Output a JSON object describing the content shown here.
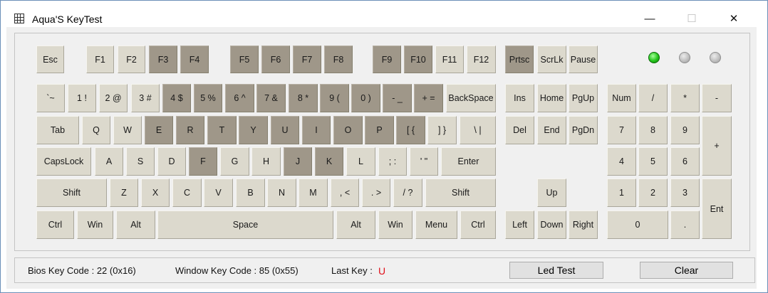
{
  "window": {
    "title": "Aqua'S KeyTest",
    "controls": {
      "minimize": "—",
      "maximize": "☐",
      "close": "✕"
    }
  },
  "colors": {
    "key_face": "#dcd9cd",
    "key_pressed": "#9f9789",
    "led_on": "#22c41a",
    "last_key": "#e0101a"
  },
  "keyboard": {
    "function_row": [
      {
        "label": "Esc",
        "pressed": false
      },
      {
        "label": "F1",
        "pressed": false
      },
      {
        "label": "F2",
        "pressed": false
      },
      {
        "label": "F3",
        "pressed": true
      },
      {
        "label": "F4",
        "pressed": true
      },
      {
        "label": "F5",
        "pressed": true
      },
      {
        "label": "F6",
        "pressed": true
      },
      {
        "label": "F7",
        "pressed": true
      },
      {
        "label": "F8",
        "pressed": true
      },
      {
        "label": "F9",
        "pressed": true
      },
      {
        "label": "F10",
        "pressed": true
      },
      {
        "label": "F11",
        "pressed": false
      },
      {
        "label": "F12",
        "pressed": false
      },
      {
        "label": "Prtsc",
        "pressed": true
      },
      {
        "label": "ScrLk",
        "pressed": false
      },
      {
        "label": "Pause",
        "pressed": false
      }
    ],
    "number_row": [
      {
        "label": "`~",
        "pressed": false
      },
      {
        "label": "1 !",
        "pressed": false
      },
      {
        "label": "2 @",
        "pressed": false
      },
      {
        "label": "3 #",
        "pressed": false
      },
      {
        "label": "4 $",
        "pressed": true
      },
      {
        "label": "5 %",
        "pressed": true
      },
      {
        "label": "6 ^",
        "pressed": true
      },
      {
        "label": "7 &",
        "pressed": true
      },
      {
        "label": "8 *",
        "pressed": true
      },
      {
        "label": "9 (",
        "pressed": true
      },
      {
        "label": "0 )",
        "pressed": true
      },
      {
        "label": "- _",
        "pressed": true
      },
      {
        "label": "+ =",
        "pressed": true
      },
      {
        "label": "BackSpace",
        "pressed": false
      }
    ],
    "tab_row": [
      {
        "label": "Tab",
        "pressed": false
      },
      {
        "label": "Q",
        "pressed": false
      },
      {
        "label": "W",
        "pressed": false
      },
      {
        "label": "E",
        "pressed": true
      },
      {
        "label": "R",
        "pressed": true
      },
      {
        "label": "T",
        "pressed": true
      },
      {
        "label": "Y",
        "pressed": true
      },
      {
        "label": "U",
        "pressed": true
      },
      {
        "label": "I",
        "pressed": true
      },
      {
        "label": "O",
        "pressed": true
      },
      {
        "label": "P",
        "pressed": true
      },
      {
        "label": "[ {",
        "pressed": true
      },
      {
        "label": "] }",
        "pressed": false
      },
      {
        "label": "\\ |",
        "pressed": false
      }
    ],
    "caps_row": [
      {
        "label": "CapsLock",
        "pressed": false
      },
      {
        "label": "A",
        "pressed": false
      },
      {
        "label": "S",
        "pressed": false
      },
      {
        "label": "D",
        "pressed": false
      },
      {
        "label": "F",
        "pressed": true
      },
      {
        "label": "G",
        "pressed": false
      },
      {
        "label": "H",
        "pressed": false
      },
      {
        "label": "J",
        "pressed": true
      },
      {
        "label": "K",
        "pressed": true
      },
      {
        "label": "L",
        "pressed": false
      },
      {
        "label": "; :",
        "pressed": false
      },
      {
        "label": "' \"",
        "pressed": false
      },
      {
        "label": "Enter",
        "pressed": false
      }
    ],
    "shift_row": [
      {
        "label": "Shift",
        "pressed": false
      },
      {
        "label": "Z",
        "pressed": false
      },
      {
        "label": "X",
        "pressed": false
      },
      {
        "label": "C",
        "pressed": false
      },
      {
        "label": "V",
        "pressed": false
      },
      {
        "label": "B",
        "pressed": false
      },
      {
        "label": "N",
        "pressed": false
      },
      {
        "label": "M",
        "pressed": false
      },
      {
        "label": ", <",
        "pressed": false
      },
      {
        "label": ". >",
        "pressed": false
      },
      {
        "label": "/ ?",
        "pressed": false
      },
      {
        "label": "Shift",
        "pressed": false
      }
    ],
    "bottom_row": [
      {
        "label": "Ctrl",
        "pressed": false
      },
      {
        "label": "Win",
        "pressed": false
      },
      {
        "label": "Alt",
        "pressed": false
      },
      {
        "label": "Space",
        "pressed": false
      },
      {
        "label": "Alt",
        "pressed": false
      },
      {
        "label": "Win",
        "pressed": false
      },
      {
        "label": "Menu",
        "pressed": false
      },
      {
        "label": "Ctrl",
        "pressed": false
      }
    ],
    "nav_keys": [
      {
        "label": "Ins",
        "pressed": false
      },
      {
        "label": "Home",
        "pressed": false
      },
      {
        "label": "PgUp",
        "pressed": false
      },
      {
        "label": "Del",
        "pressed": false
      },
      {
        "label": "End",
        "pressed": false
      },
      {
        "label": "PgDn",
        "pressed": false
      },
      {
        "label": "Up",
        "pressed": false
      },
      {
        "label": "Left",
        "pressed": false
      },
      {
        "label": "Down",
        "pressed": false
      },
      {
        "label": "Right",
        "pressed": false
      }
    ],
    "numpad": [
      {
        "label": "Num",
        "pressed": false
      },
      {
        "label": "/",
        "pressed": false
      },
      {
        "label": "*",
        "pressed": false
      },
      {
        "label": "-",
        "pressed": false
      },
      {
        "label": "7",
        "pressed": false
      },
      {
        "label": "8",
        "pressed": false
      },
      {
        "label": "9",
        "pressed": false
      },
      {
        "label": "+",
        "pressed": false
      },
      {
        "label": "4",
        "pressed": false
      },
      {
        "label": "5",
        "pressed": false
      },
      {
        "label": "6",
        "pressed": false
      },
      {
        "label": "1",
        "pressed": false
      },
      {
        "label": "2",
        "pressed": false
      },
      {
        "label": "3",
        "pressed": false
      },
      {
        "label": "Ent",
        "pressed": false
      },
      {
        "label": "0",
        "pressed": false
      },
      {
        "label": ".",
        "pressed": false
      }
    ],
    "leds": [
      {
        "state": "on"
      },
      {
        "state": "off"
      },
      {
        "state": "off"
      }
    ]
  },
  "status": {
    "bios_key_code": "Bios Key Code : 22 (0x16)",
    "window_key_code": "Window Key Code : 85 (0x55)",
    "last_key_label": "Last Key :",
    "last_key_value": "U"
  },
  "buttons": {
    "led_test": "Led Test",
    "clear": "Clear"
  }
}
